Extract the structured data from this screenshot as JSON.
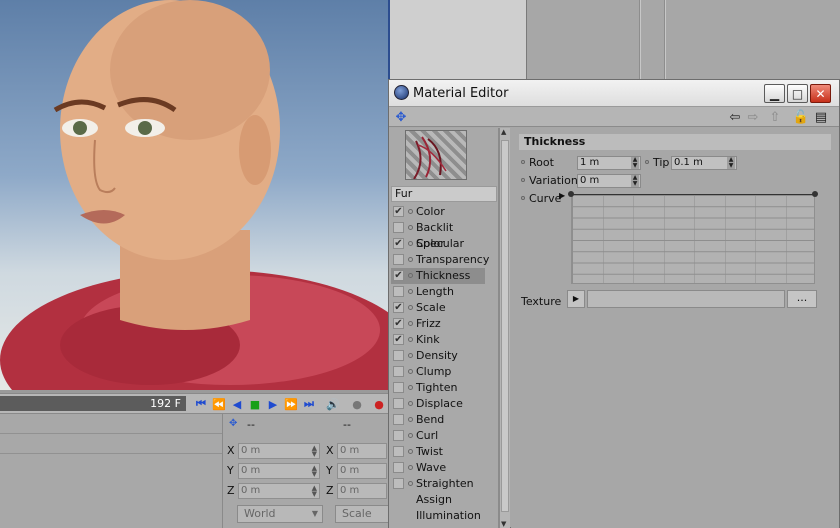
{
  "viewport": {
    "frame_count": "192 F"
  },
  "coords": {
    "panel_header_left": "--",
    "panel_header_right": "--",
    "rows": [
      {
        "axis": "X",
        "pos": "0 m",
        "axis2": "X",
        "size": "0 m"
      },
      {
        "axis": "Y",
        "pos": "0 m",
        "axis2": "Y",
        "size": "0 m"
      },
      {
        "axis": "Z",
        "pos": "0 m",
        "axis2": "Z",
        "size": "0 m"
      }
    ],
    "space_select": "World",
    "mode_select": "Scale"
  },
  "material_editor": {
    "title": "Material Editor",
    "material_name": "Fur",
    "channels": [
      {
        "label": "Color",
        "checked": true
      },
      {
        "label": "Backlit Color",
        "checked": false
      },
      {
        "label": "Specular",
        "checked": true
      },
      {
        "label": "Transparency",
        "checked": false
      },
      {
        "label": "Thickness",
        "checked": true,
        "selected": true
      },
      {
        "label": "Length",
        "checked": false
      },
      {
        "label": "Scale",
        "checked": true
      },
      {
        "label": "Frizz",
        "checked": true
      },
      {
        "label": "Kink",
        "checked": true
      },
      {
        "label": "Density",
        "checked": false
      },
      {
        "label": "Clump",
        "checked": false
      },
      {
        "label": "Tighten",
        "checked": false
      },
      {
        "label": "Displace",
        "checked": false
      },
      {
        "label": "Bend",
        "checked": false
      },
      {
        "label": "Curl",
        "checked": false
      },
      {
        "label": "Twist",
        "checked": false
      },
      {
        "label": "Wave",
        "checked": false
      },
      {
        "label": "Straighten",
        "checked": false
      }
    ],
    "extra_items": [
      "Assign",
      "Illumination"
    ],
    "panel": {
      "header": "Thickness",
      "root_label": "Root",
      "root_value": "1 m",
      "tip_label": "Tip",
      "tip_value": "0.1 m",
      "variation_label": "Variation",
      "variation_value": "0 m",
      "curve_label": "Curve",
      "texture_label": "Texture",
      "texture_button": "..."
    }
  }
}
